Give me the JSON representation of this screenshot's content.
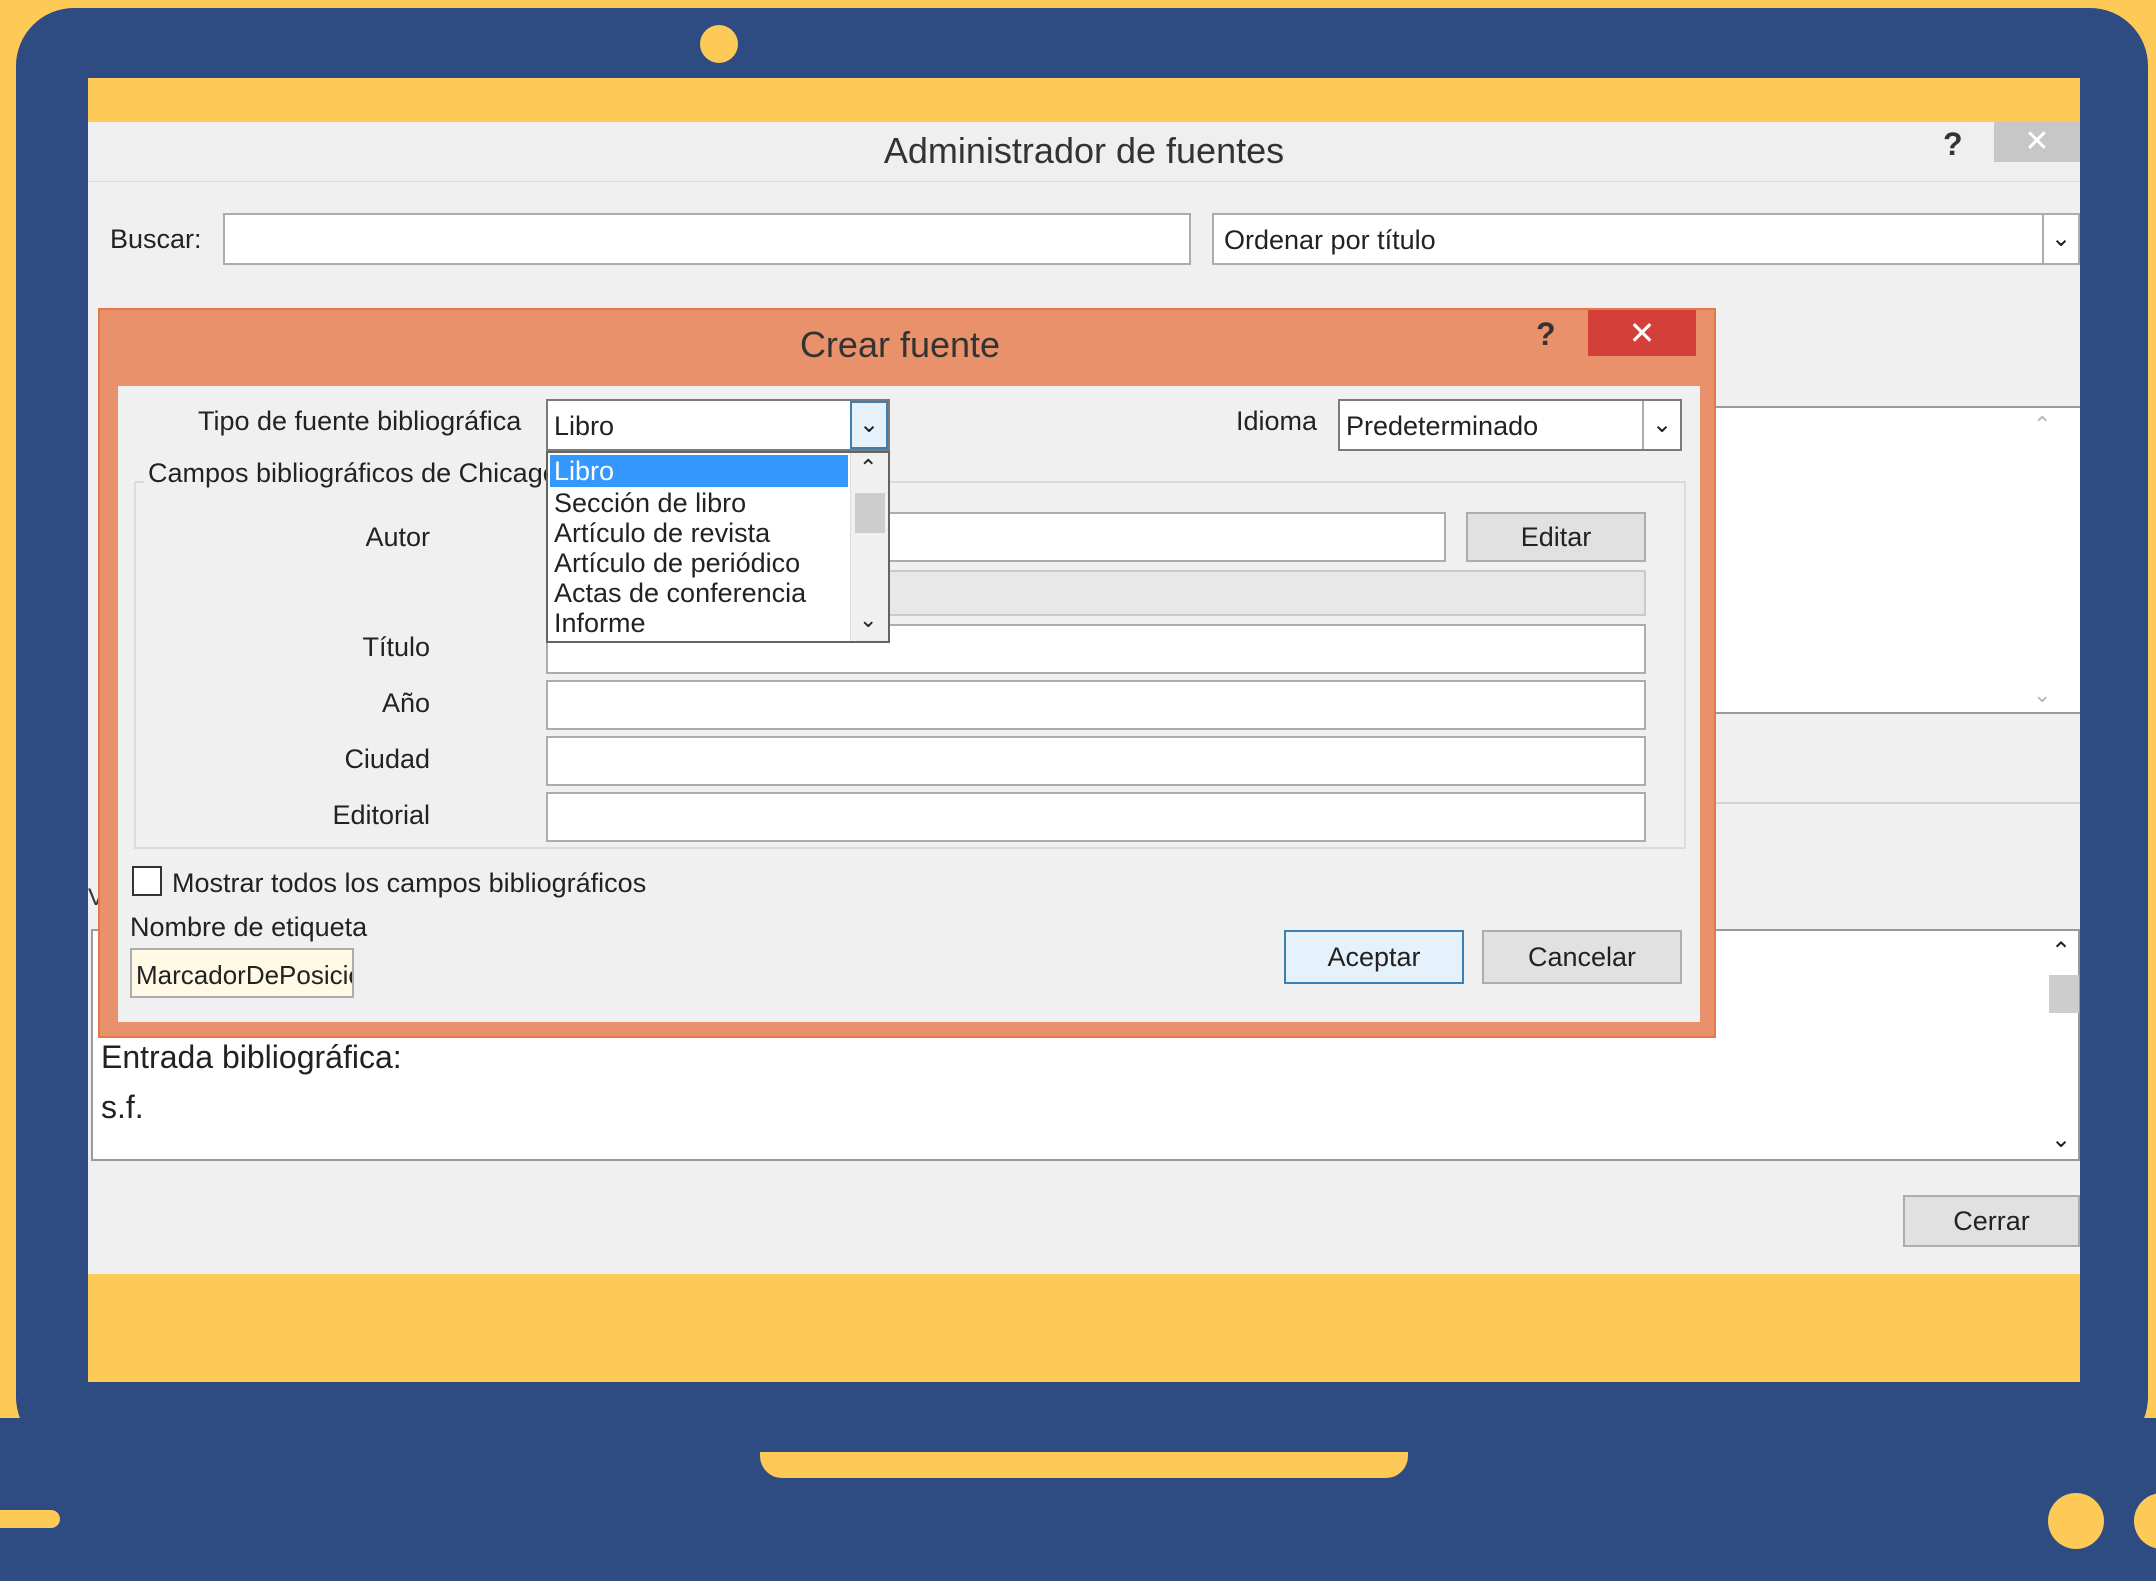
{
  "manager": {
    "title": "Administrador de fuentes",
    "help": "?",
    "close": "✕",
    "search_label": "Buscar:",
    "search_value": "",
    "sort_value": "Ordenar por título",
    "cut_letter": "V",
    "preview_heading": "Entrada bibliográfica:",
    "preview_text": "s.f.",
    "close_button": "Cerrar"
  },
  "dialog": {
    "title": "Crear fuente",
    "help": "?",
    "close": "✕",
    "type_label": "Tipo de fuente bibliográfica",
    "type_value": "Libro",
    "type_options": [
      "Libro",
      "Sección de libro",
      "Artículo de revista",
      "Artículo de periódico",
      "Actas de conferencia",
      "Informe"
    ],
    "language_label": "Idioma",
    "language_value": "Predeterminado",
    "group_label": "Campos bibliográficos de Chicago,",
    "fields": {
      "author": "Autor",
      "title": "Título",
      "year": "Año",
      "city": "Ciudad",
      "publisher": "Editorial"
    },
    "edit_button": "Editar",
    "show_all_label": "Mostrar todos los campos bibliográficos",
    "tag_label": "Nombre de etiqueta",
    "tag_value": "MarcadorDePosicio",
    "ok_button": "Aceptar",
    "cancel_button": "Cancelar"
  },
  "icons": {
    "dropdown": "chevron-down-icon",
    "scroll_up": "chevron-up-icon",
    "close": "close-icon",
    "help": "help-icon"
  },
  "colors": {
    "frame": "#2E4B82",
    "accent_yellow": "#FECA57",
    "dialog_border": "#E8916A",
    "close_red": "#D43F3A",
    "selection": "#3399FF"
  }
}
